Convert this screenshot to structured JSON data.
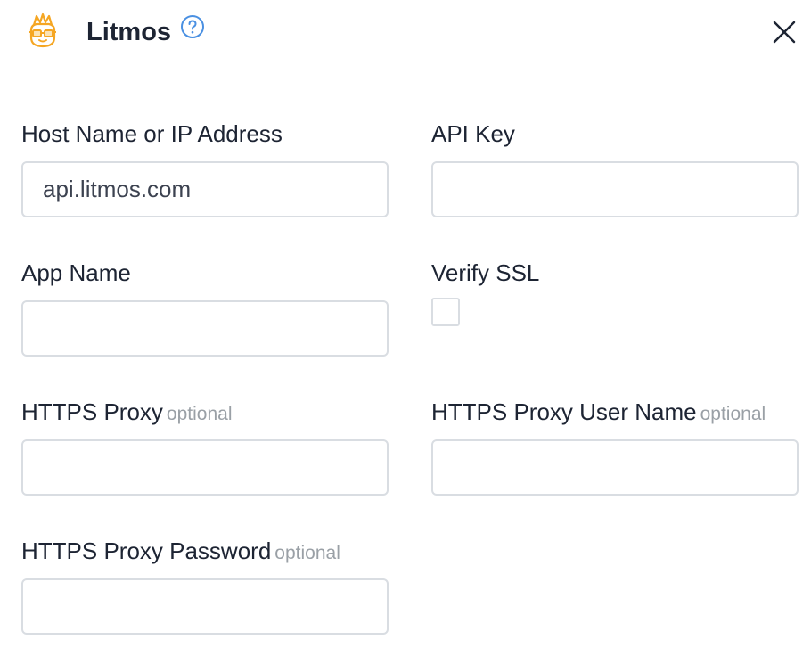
{
  "header": {
    "title": "Litmos",
    "help_icon": "question-circle-icon",
    "close_icon": "close-icon",
    "logo_icon": "litmos-logo-icon",
    "accent_color": "#4a90e2",
    "logo_color": "#f5a623"
  },
  "fields": {
    "host": {
      "label": "Host Name or IP Address",
      "value": "api.litmos.com",
      "placeholder": ""
    },
    "api_key": {
      "label": "API Key",
      "value": "",
      "placeholder": ""
    },
    "app_name": {
      "label": "App Name",
      "value": "",
      "placeholder": ""
    },
    "verify_ssl": {
      "label": "Verify SSL",
      "checked": false
    },
    "https_proxy": {
      "label": "HTTPS Proxy",
      "optional": "optional",
      "value": ""
    },
    "https_proxy_user": {
      "label": "HTTPS Proxy User Name",
      "optional": "optional",
      "value": ""
    },
    "https_proxy_password": {
      "label": "HTTPS Proxy Password",
      "optional": "optional",
      "value": ""
    }
  }
}
